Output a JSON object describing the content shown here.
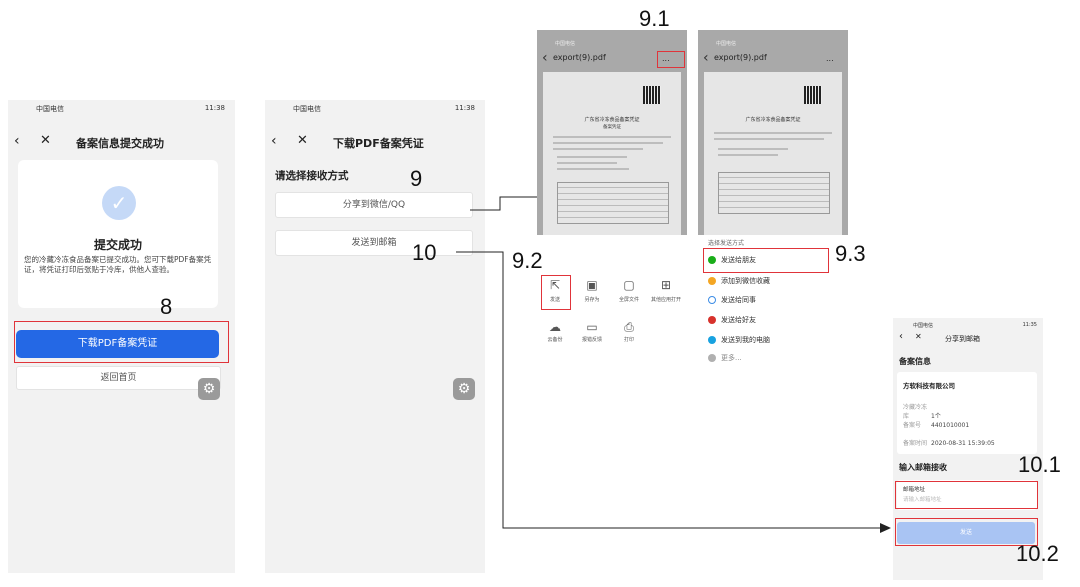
{
  "status_bar": {
    "carrier": "中国电信",
    "time": "11:38",
    "time_small": "11:35"
  },
  "screen1": {
    "title": "备案信息提交成功",
    "success_title": "提交成功",
    "success_desc": "您的冷藏冷冻食品备案已提交成功。您可下载PDF备案凭证，将凭证打印后张贴于冷库，供他人查验。",
    "download_button": "下载PDF备案凭证",
    "home_button": "返回首页"
  },
  "screen2": {
    "title": "下载PDF备案凭证",
    "prompt": "请选择接收方式",
    "share_button": "分享到微信/QQ",
    "email_button": "发送到邮箱"
  },
  "screen3": {
    "file_title": "export(9).pdf",
    "menu_label": "...",
    "doc_title": "广东省冷冻食品备案凭证",
    "doc_sub": "备案凭证",
    "actions_row1": [
      "发送",
      "另存为",
      "全屏文件",
      "其他应用打开"
    ],
    "actions_row2": [
      "云备份",
      "报错反馈",
      "打印"
    ]
  },
  "screen4": {
    "file_title": "export(9).pdf",
    "menu_label": "...",
    "sheet_title": "选择发送方式",
    "options": [
      "发送给朋友",
      "添加到微信收藏",
      "发送给同事",
      "发送给好友",
      "发送到我的电脑",
      "更多..."
    ]
  },
  "screen5": {
    "title": "分享到邮箱",
    "section_info": "备案信息",
    "company": "方软科技有限公司",
    "rows": [
      {
        "k": "冷藏冷冻库",
        "v": "1个"
      },
      {
        "k": "备案号",
        "v": "4401010001"
      },
      {
        "k": "备案时间",
        "v": "2020-08-31 15:39:05"
      }
    ],
    "section_email": "输入邮箱接收",
    "email_label": "邮箱地址",
    "email_placeholder": "请输入邮箱地址",
    "send_button": "发送"
  },
  "step_labels": {
    "s8": "8",
    "s9": "9",
    "s9_1": "9.1",
    "s9_2": "9.2",
    "s9_3": "9.3",
    "s10": "10",
    "s10_1": "10.1",
    "s10_2": "10.2"
  },
  "colors": {
    "primary": "#2468e5",
    "highlight": "#e0343a",
    "success_icon": "#c5d9f7"
  }
}
